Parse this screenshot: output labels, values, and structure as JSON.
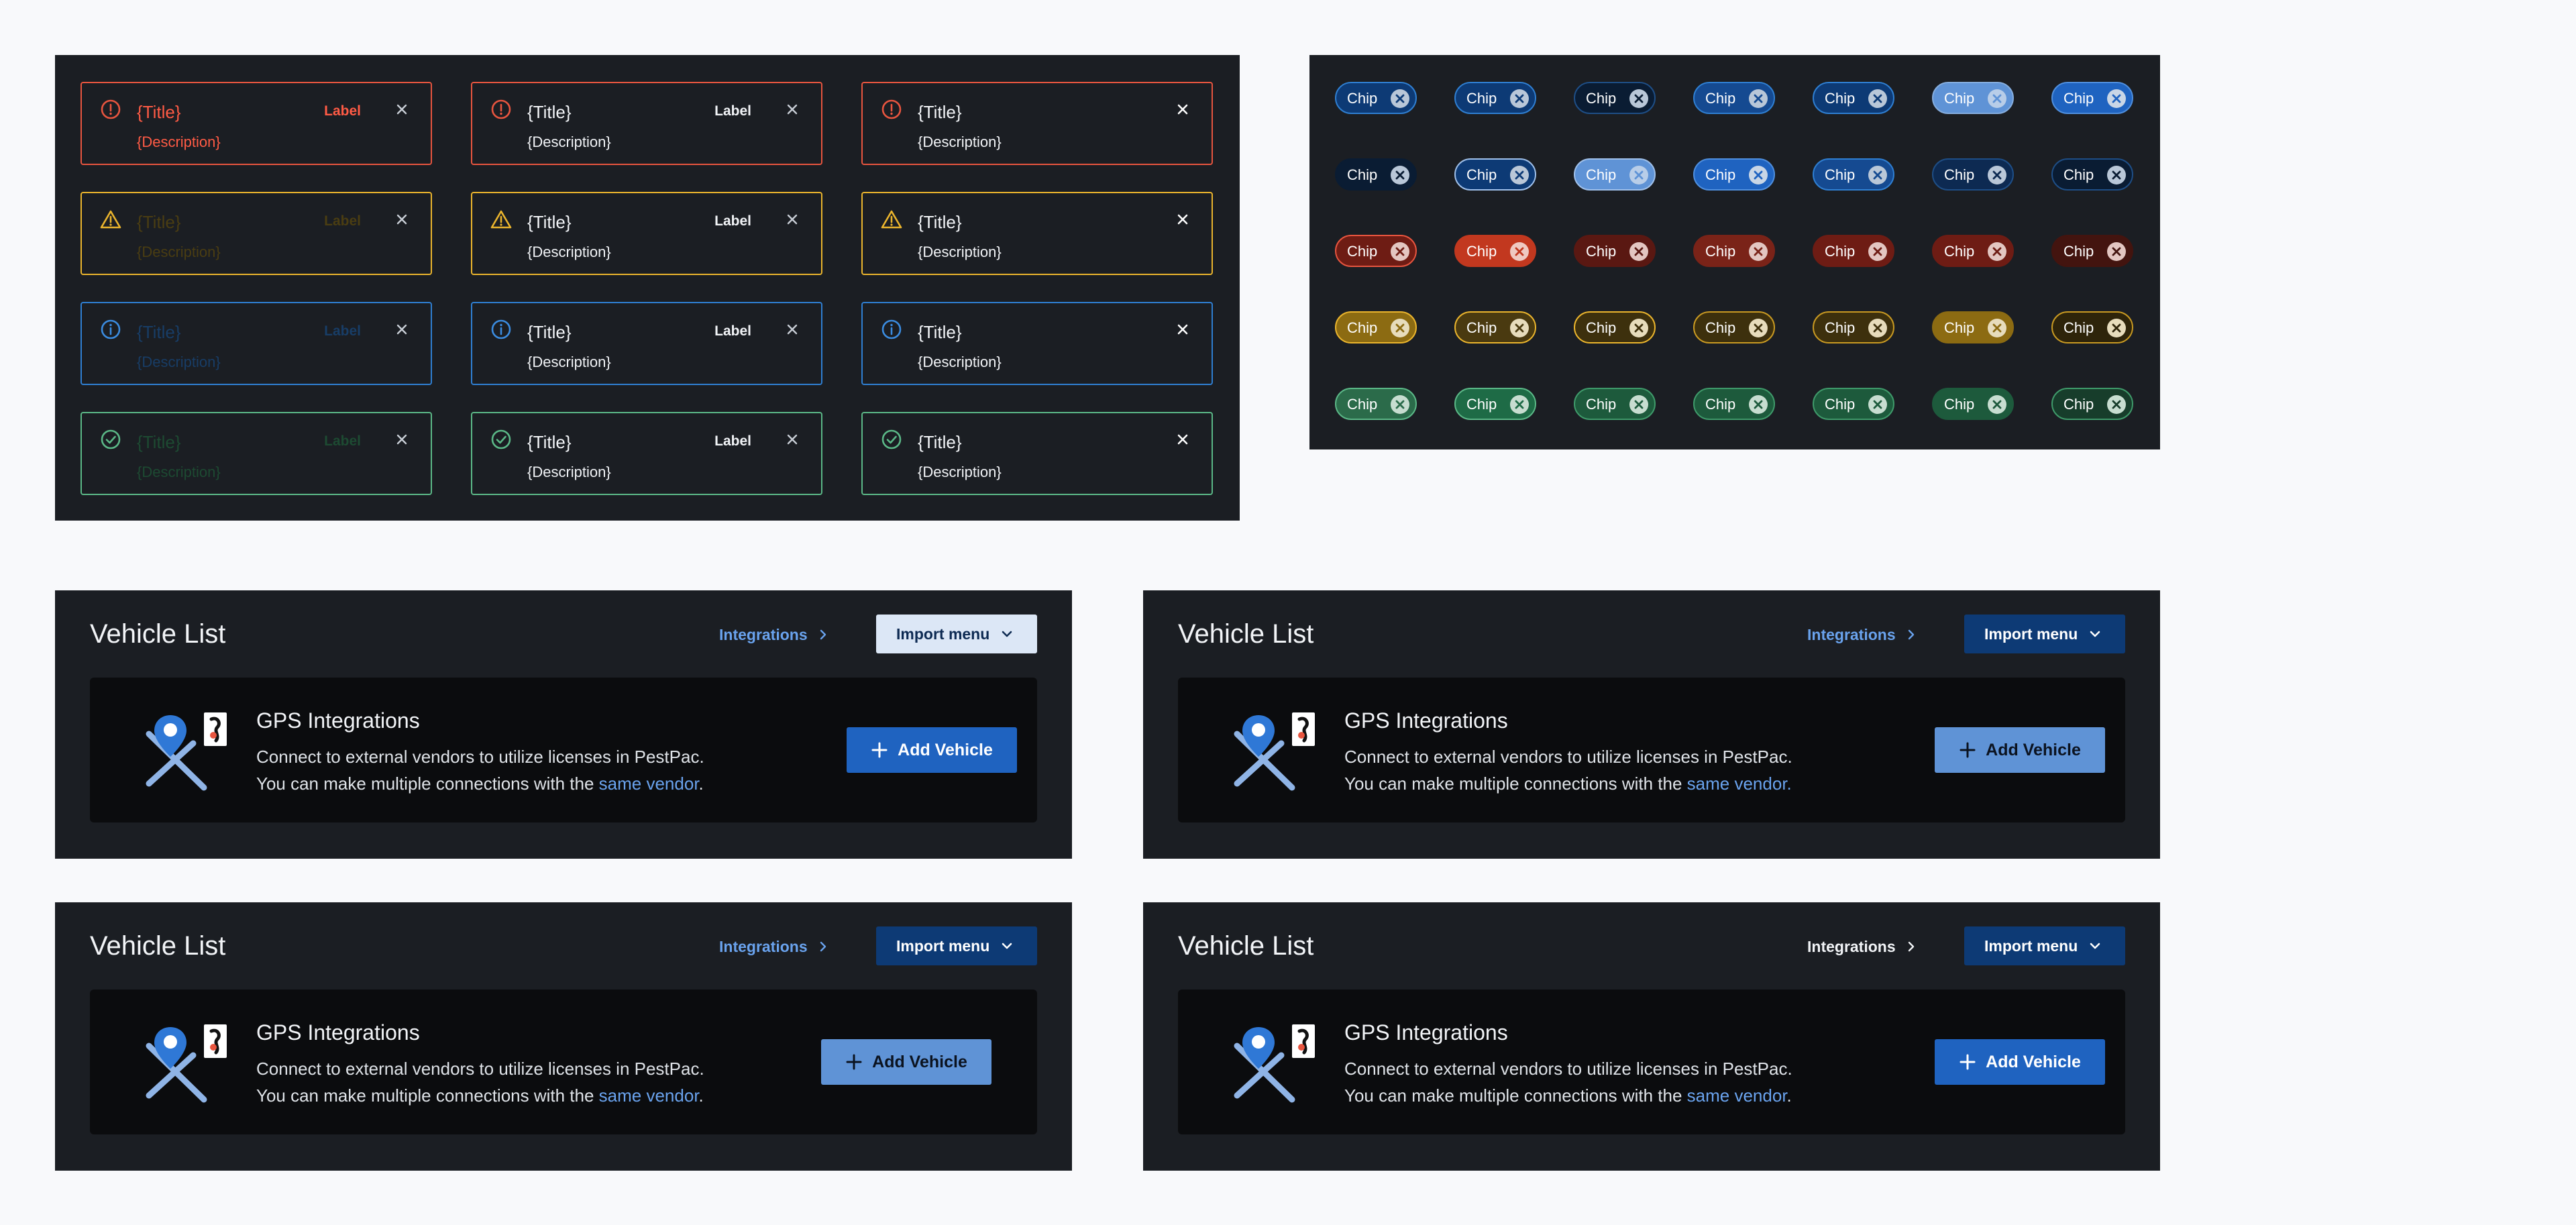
{
  "alerts": {
    "rows": [
      {
        "type": "error",
        "icon": "error-circle-icon",
        "items": [
          {
            "title": "{Title}",
            "description": "{Description}",
            "label": "Label"
          },
          {
            "title": "{Title}",
            "description": "{Description}",
            "label": "Label"
          },
          {
            "title": "{Title}",
            "description": "{Description}"
          }
        ]
      },
      {
        "type": "warning",
        "icon": "warning-triangle-icon",
        "items": [
          {
            "title": "{Title}",
            "description": "{Description}",
            "label": "Label"
          },
          {
            "title": "{Title}",
            "description": "{Description}",
            "label": "Label"
          },
          {
            "title": "{Title}",
            "description": "{Description}"
          }
        ]
      },
      {
        "type": "info",
        "icon": "info-circle-icon",
        "items": [
          {
            "title": "{Title}",
            "description": "{Description}",
            "label": "Label"
          },
          {
            "title": "{Title}",
            "description": "{Description}",
            "label": "Label"
          },
          {
            "title": "{Title}",
            "description": "{Description}"
          }
        ]
      },
      {
        "type": "success",
        "icon": "check-circle-icon",
        "items": [
          {
            "title": "{Title}",
            "description": "{Description}",
            "label": "Label"
          },
          {
            "title": "{Title}",
            "description": "{Description}",
            "label": "Label"
          },
          {
            "title": "{Title}",
            "description": "{Description}"
          }
        ]
      }
    ],
    "colors": {
      "error": "#e8553f",
      "warning": "#ebb52d",
      "info": "#2f7fd2",
      "success": "#5bb887"
    }
  },
  "chips": {
    "label": "Chip",
    "remove_icon": "close-circle-icon",
    "rows": [
      {
        "variant": "blue",
        "styles": [
          {
            "bg": "#0d3a75",
            "border": "#2f7fd2",
            "x": "#b9c7d8",
            "xmark": "#0d3a75"
          },
          {
            "bg": "#0d3a75",
            "border": "#2f7fd2",
            "x": "#b9c7d8",
            "xmark": "#0d3a75"
          },
          {
            "bg": "#0a1c33",
            "border": "#1e4e86",
            "x": "#b9c7d8",
            "xmark": "#0a1c33"
          },
          {
            "bg": "#154a91",
            "border": "#2f7fd2",
            "x": "#b9c7d8",
            "xmark": "#154a91"
          },
          {
            "bg": "#0d3a75",
            "border": "#2f7fd2",
            "x": "#b9c7d8",
            "xmark": "#0d3a75"
          },
          {
            "bg": "#5f93d6",
            "border": "#85adde",
            "x": "#b8cde8",
            "xmark": "#5f93d6"
          },
          {
            "bg": "#1f63c0",
            "border": "#4f8fde",
            "x": "#c9d6e6",
            "xmark": "#1f63c0"
          }
        ]
      },
      {
        "variant": "blue-alt",
        "styles": [
          {
            "bg": "#0a1c33",
            "border": "#0a1c33",
            "x": "#b9c7d8",
            "xmark": "#0a1c33"
          },
          {
            "bg": "#0d3a75",
            "border": "#9fc0ea",
            "x": "#b9c7d8",
            "xmark": "#0d3a75"
          },
          {
            "bg": "#5f93d6",
            "border": "#9fc0ea",
            "x": "#b8cde8",
            "xmark": "#5f93d6"
          },
          {
            "bg": "#1f63c0",
            "border": "#4f8fde",
            "x": "#c9d6e6",
            "xmark": "#1f63c0"
          },
          {
            "bg": "#154a91",
            "border": "#2f7fd2",
            "x": "#b9c7d8",
            "xmark": "#154a91"
          },
          {
            "bg": "#0d2a52",
            "border": "#1e4e86",
            "x": "#b9c7d8",
            "xmark": "#0d2a52"
          },
          {
            "bg": "#0a1c33",
            "border": "#1e4e86",
            "x": "#b9c7d8",
            "xmark": "#0a1c33"
          }
        ]
      },
      {
        "variant": "red",
        "styles": [
          {
            "bg": "#6e1c14",
            "border": "#e8553f",
            "x": "#e3c6c1",
            "xmark": "#6e1c14"
          },
          {
            "bg": "#c2381f",
            "border": "#c2381f",
            "x": "#efc9c1",
            "xmark": "#c2381f"
          },
          {
            "bg": "#5a1812",
            "border": "#5a1812",
            "x": "#e3c6c1",
            "xmark": "#5a1812"
          },
          {
            "bg": "#7a2318",
            "border": "#7a2318",
            "x": "#e3c6c1",
            "xmark": "#7a2318"
          },
          {
            "bg": "#6e1c14",
            "border": "#6e1c14",
            "x": "#e3c6c1",
            "xmark": "#6e1c14"
          },
          {
            "bg": "#6e1c14",
            "border": "#6e1c14",
            "x": "#e3c6c1",
            "xmark": "#6e1c14"
          },
          {
            "bg": "#43140f",
            "border": "#43140f",
            "x": "#e3c6c1",
            "xmark": "#43140f"
          }
        ]
      },
      {
        "variant": "yellow",
        "styles": [
          {
            "bg": "#8c6b12",
            "border": "#ebb52d",
            "x": "#e7dcbc",
            "xmark": "#8c6b12"
          },
          {
            "bg": "#4a3a10",
            "border": "#ebb52d",
            "x": "#e7dcbc",
            "xmark": "#4a3a10"
          },
          {
            "bg": "#3d300d",
            "border": "#ebb52d",
            "x": "#e7dcbc",
            "xmark": "#3d300d"
          },
          {
            "bg": "#3d300d",
            "border": "#c99a22",
            "x": "#e7dcbc",
            "xmark": "#3d300d"
          },
          {
            "bg": "#3d300d",
            "border": "#c99a22",
            "x": "#e7dcbc",
            "xmark": "#3d300d"
          },
          {
            "bg": "#8c6b12",
            "border": "#8c6b12",
            "x": "#e7dcbc",
            "xmark": "#8c6b12"
          },
          {
            "bg": "#2e240a",
            "border": "#c99a22",
            "x": "#e7dcbc",
            "xmark": "#2e240a"
          }
        ]
      },
      {
        "variant": "green",
        "styles": [
          {
            "bg": "#2b6b4a",
            "border": "#5bb887",
            "x": "#c7ddd0",
            "xmark": "#2b6b4a"
          },
          {
            "bg": "#1e6b46",
            "border": "#5bb887",
            "x": "#c7ddd0",
            "xmark": "#1e6b46"
          },
          {
            "bg": "#1d5a3c",
            "border": "#3f9a6a",
            "x": "#c7ddd0",
            "xmark": "#1d5a3c"
          },
          {
            "bg": "#1d5a3c",
            "border": "#3f9a6a",
            "x": "#c7ddd0",
            "xmark": "#1d5a3c"
          },
          {
            "bg": "#1d5a3c",
            "border": "#3f9a6a",
            "x": "#c7ddd0",
            "xmark": "#1d5a3c"
          },
          {
            "bg": "#1d5a3c",
            "border": "#1d5a3c",
            "x": "#c7ddd0",
            "xmark": "#1d5a3c"
          },
          {
            "bg": "#173d2b",
            "border": "#3f9a6a",
            "x": "#c7ddd0",
            "xmark": "#173d2b"
          }
        ]
      }
    ]
  },
  "vehicle_cards": [
    {
      "title": "Vehicle List",
      "breadcrumb": {
        "label": "Integrations",
        "color": "#6aa3ee"
      },
      "import_menu": {
        "label": "Import menu",
        "bg": "#dce7f6",
        "fg": "#0d2a52"
      },
      "gps": {
        "title": "GPS Integrations",
        "line1": "Connect to external vendors to utilize licenses in PestPac.",
        "line2_prefix": "You can make multiple connections with the ",
        "link": "same vendor",
        "line2_suffix": "."
      },
      "add_button": {
        "label": "Add Vehicle",
        "bg": "#1f63c0",
        "fg": "#ffffff"
      }
    },
    {
      "title": "Vehicle List",
      "breadcrumb": {
        "label": "Integrations",
        "color": "#6aa3ee"
      },
      "import_menu": {
        "label": "Import menu",
        "bg": "#0d3a75",
        "fg": "#ffffff"
      },
      "gps": {
        "title": "GPS Integrations",
        "line1": "Connect to external vendors to utilize licenses in PestPac.",
        "line2_prefix": "You can make multiple connections with the ",
        "link": "same vendor.",
        "line2_suffix": ""
      },
      "add_button": {
        "label": "Add Vehicle",
        "bg": "#5f93d6",
        "fg": "#0b1320"
      }
    },
    {
      "title": "Vehicle List",
      "breadcrumb": {
        "label": "Integrations",
        "color": "#6aa3ee"
      },
      "import_menu": {
        "label": "Import menu",
        "bg": "#0d3a75",
        "fg": "#ffffff"
      },
      "gps": {
        "title": "GPS Integrations",
        "line1": "Connect to external vendors to utilize licenses in PestPac.",
        "line2_prefix": "You can make multiple connections with the ",
        "link": "same vendor",
        "line2_suffix": "."
      },
      "add_button": {
        "label": "Add Vehicle",
        "bg": "#5f93d6",
        "fg": "#0b1320"
      }
    },
    {
      "title": "Vehicle List",
      "breadcrumb": {
        "label": "Integrations",
        "color": "#f2f4f7"
      },
      "import_menu": {
        "label": "Import menu",
        "bg": "#0d3a75",
        "fg": "#ffffff"
      },
      "gps": {
        "title": "GPS Integrations",
        "line1": "Connect to external vendors to utilize licenses in PestPac.",
        "line2_prefix": "You can make multiple connections with the ",
        "link": "same vendor",
        "line2_suffix": "."
      },
      "add_button": {
        "label": "Add Vehicle",
        "bg": "#1f63c0",
        "fg": "#ffffff"
      }
    }
  ]
}
